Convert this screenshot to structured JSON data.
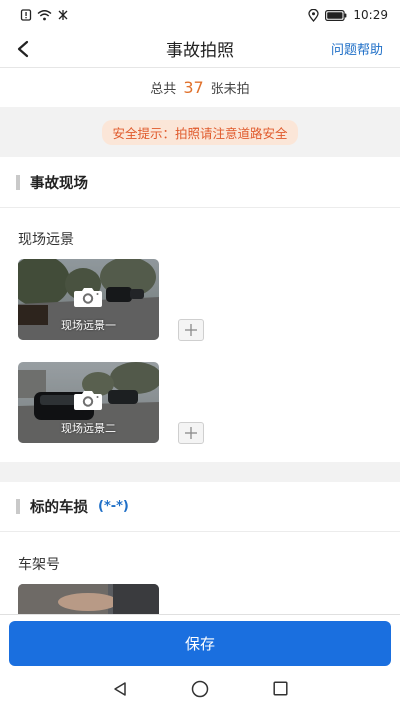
{
  "status_bar": {
    "time": "10:29",
    "left_icons": [
      "notification-icon",
      "wifi-icon",
      "signal-icon"
    ],
    "right_icons": [
      "location-icon",
      "battery-icon"
    ]
  },
  "nav": {
    "back_icon": "back-arrow-icon",
    "title": "事故拍照",
    "help_label": "问题帮助"
  },
  "summary": {
    "prefix": "总共",
    "count": "37",
    "suffix": "张未拍"
  },
  "tip": {
    "text": "安全提示：拍照请注意道路安全"
  },
  "sections": [
    {
      "title": "事故现场",
      "extra": "",
      "subsection": "现场远景",
      "photos": [
        {
          "caption": "现场远景一"
        },
        {
          "caption": "现场远景二"
        }
      ]
    },
    {
      "title": "标的车损",
      "extra": "(*-*)",
      "subsection": "车架号",
      "photos": []
    }
  ],
  "save_label": "保存",
  "colors": {
    "accent": "#1a6fdf",
    "count": "#e0712c",
    "tip_text": "#e05a2c",
    "tip_bg": "#fbe6d8",
    "link": "#1f6fc7"
  },
  "android_nav": [
    "back-triangle-icon",
    "home-circle-icon",
    "recents-square-icon"
  ]
}
